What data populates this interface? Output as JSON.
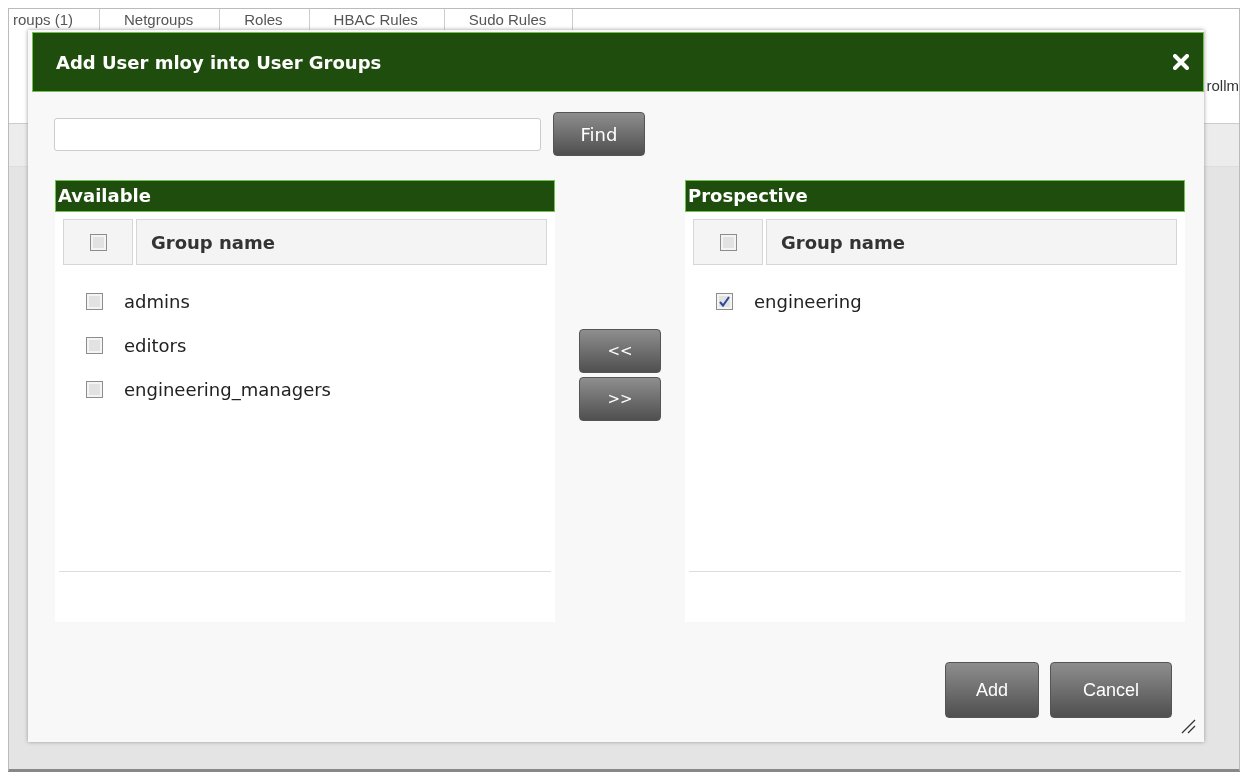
{
  "background_tabs": [
    {
      "label": "roups (1)"
    },
    {
      "label": "Netgroups"
    },
    {
      "label": "Roles"
    },
    {
      "label": "HBAC Rules"
    },
    {
      "label": "Sudo Rules"
    }
  ],
  "background_text": "rollm",
  "dialog": {
    "title": "Add User mloy into User Groups",
    "find_button": "Find",
    "panels": [
      {
        "title": "Available",
        "column": "Group name",
        "header_checked": false,
        "rows": [
          {
            "name": "admins",
            "checked": false
          },
          {
            "name": "editors",
            "checked": false
          },
          {
            "name": "engineering_managers",
            "checked": false
          }
        ]
      },
      {
        "title": "Prospective",
        "column": "Group name",
        "header_checked": false,
        "rows": [
          {
            "name": "engineering",
            "checked": true
          }
        ]
      }
    ],
    "move_buttons": [
      "<<",
      ">>"
    ],
    "buttons": [
      "Add",
      "Cancel"
    ]
  }
}
